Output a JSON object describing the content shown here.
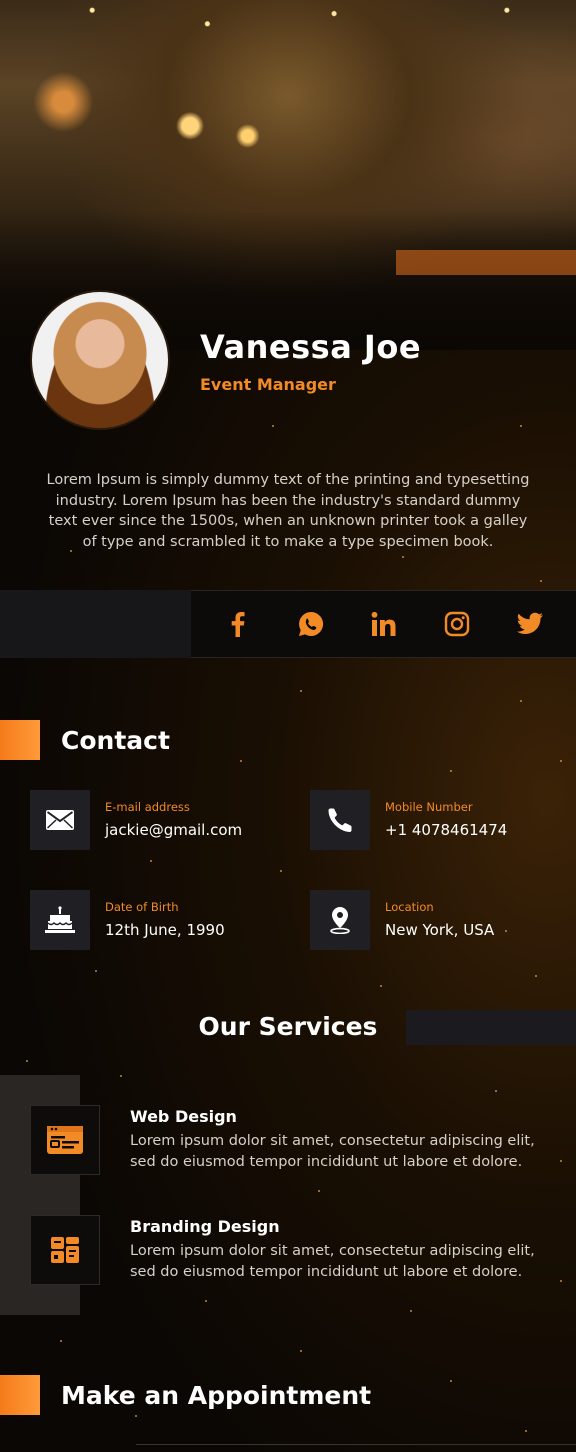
{
  "profile": {
    "name": "Vanessa Joe",
    "role": "Event Manager",
    "bio": "Lorem Ipsum is simply dummy text of the printing and typesetting industry. Lorem Ipsum has been the industry's standard dummy text ever since the 1500s, when an unknown printer took a galley of type and scrambled it to make a type specimen book."
  },
  "social": [
    {
      "icon": "facebook-icon"
    },
    {
      "icon": "whatsapp-icon"
    },
    {
      "icon": "linkedin-icon"
    },
    {
      "icon": "instagram-icon"
    },
    {
      "icon": "twitter-icon"
    }
  ],
  "contact": {
    "title": "Contact",
    "items": [
      {
        "label": "E-mail address",
        "value": "jackie@gmail.com",
        "icon": "envelope-icon"
      },
      {
        "label": "Mobile Number",
        "value": "+1 4078461474",
        "icon": "phone-icon"
      },
      {
        "label": "Date of Birth",
        "value": "12th June, 1990",
        "icon": "cake-icon"
      },
      {
        "label": "Location",
        "value": "New York, USA",
        "icon": "location-pin-icon"
      }
    ]
  },
  "services": {
    "title": "Our Services",
    "items": [
      {
        "name": "Web Design",
        "description": "Lorem ipsum dolor sit amet, consectetur adipiscing elit, sed do eiusmod tempor incididunt ut labore et dolore.",
        "icon": "web-design-icon"
      },
      {
        "name": "Branding Design",
        "description": "Lorem ipsum dolor sit amet, consectetur adipiscing elit, sed do eiusmod tempor incididunt ut labore et dolore.",
        "icon": "branding-design-icon"
      }
    ]
  },
  "appointment": {
    "title": "Make an Appointment"
  },
  "colors": {
    "accent": "#f28a26",
    "background": "#0b0704",
    "tile": "#202024"
  }
}
